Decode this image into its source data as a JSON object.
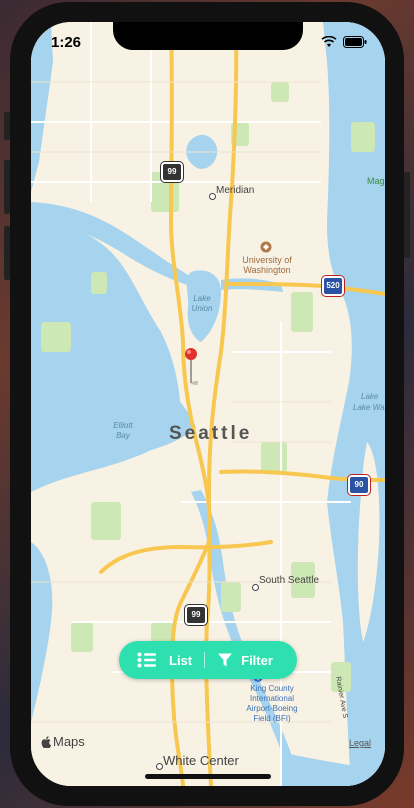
{
  "status_bar": {
    "time": "1:26"
  },
  "map": {
    "neighborhoods": {
      "meridian": "Meridian",
      "university_of_washington": "University of Washington",
      "seattle": "Seattle",
      "south_seattle": "South Seattle",
      "white_center": "White Center",
      "king_county_airport": "King County International Airport-Boeing Field (BFI)",
      "lake_washington": "Lake Washin",
      "rainier_ave": "Rainier Ave S",
      "magnolia_partial": "Mag"
    },
    "water_labels": {
      "lake_union": "Lake Union",
      "elliott_bay": "Elliott Bay",
      "lake": "Lake"
    },
    "route_shields": {
      "sr99_north": "99",
      "sr99_south": "99",
      "sr520": "520",
      "i90": "90"
    },
    "colors": {
      "water": "#a6d4ee",
      "land": "#f8f2e4",
      "park": "#cde8b4",
      "highway": "#f7c74f"
    }
  },
  "toolbar": {
    "list_label": "List",
    "filter_label": "Filter",
    "list_icon": "list-icon",
    "filter_icon": "filter-icon",
    "accent": "#2ee0b0"
  },
  "attribution": {
    "maps_label": "Maps",
    "legal_label": "Legal"
  }
}
